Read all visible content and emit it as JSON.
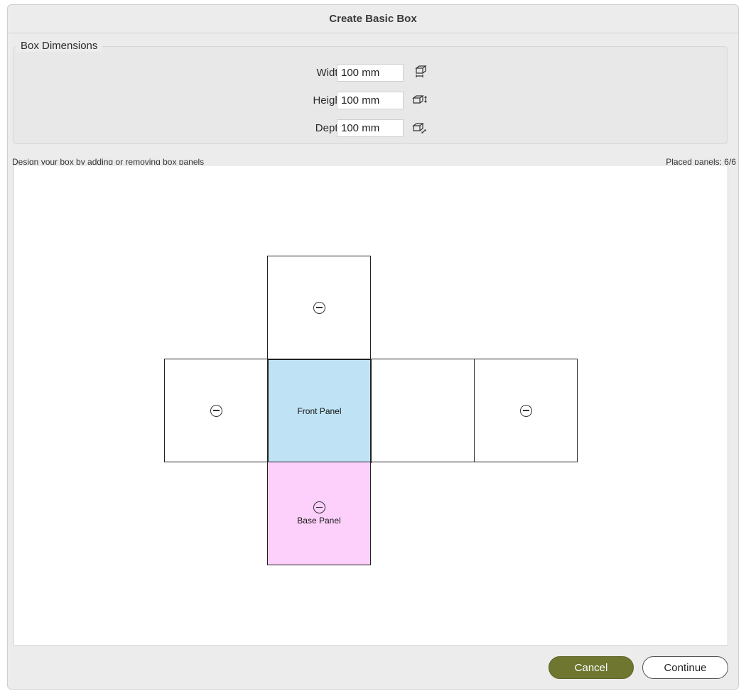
{
  "dialog": {
    "title": "Create Basic Box"
  },
  "dimensions": {
    "legend": "Box Dimensions",
    "width": {
      "label": "Width:",
      "value": "100 mm",
      "icon": "box-width-icon"
    },
    "height": {
      "label": "Height:",
      "value": "100 mm",
      "icon": "box-height-icon"
    },
    "depth": {
      "label": "Depth:",
      "value": "100 mm",
      "icon": "box-depth-icon"
    }
  },
  "design": {
    "hint": "Design your box by adding or removing box panels",
    "placed": "Placed panels: 6/6"
  },
  "panels": {
    "front_label": "Front Panel",
    "base_label": "Base Panel",
    "front_color": "#bfe3f5",
    "base_color": "#fdd0fb"
  },
  "buttons": {
    "cancel": "Cancel",
    "continue": "Continue",
    "cancel_color": "#6e7630"
  }
}
